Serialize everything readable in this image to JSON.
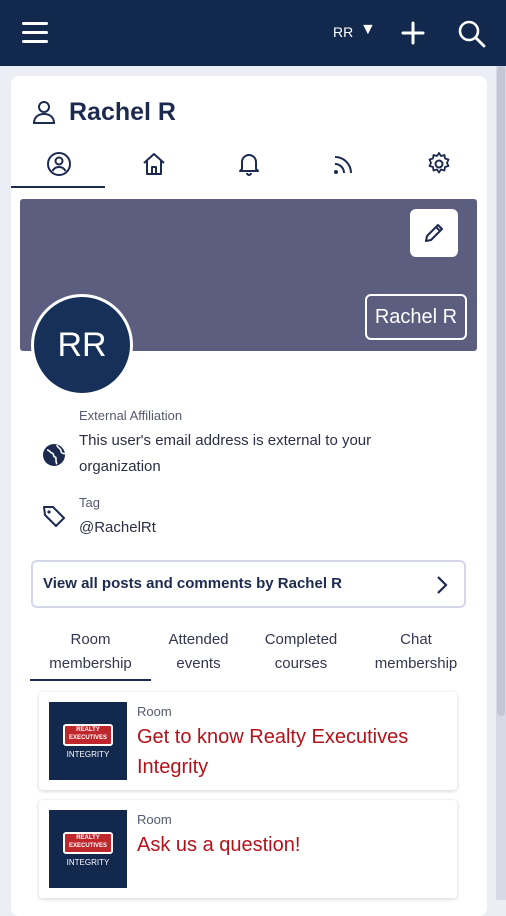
{
  "header": {
    "user_initials": "RR",
    "colors": {
      "bar": "#13284d",
      "accent": "#b3121a"
    }
  },
  "profile": {
    "name": "Rachel R",
    "avatar_initials": "RR",
    "banner_name": "Rachel R",
    "external_affiliation_label": "External Affiliation",
    "external_affiliation_value": "This user's email address is external to your organization",
    "tag_label": "Tag",
    "tag_value": "@RachelRt",
    "posts_link": "View all posts and comments by Rachel R"
  },
  "tabs": [
    "profile-icon",
    "home-icon",
    "bell-icon",
    "rss-icon",
    "gear-icon"
  ],
  "sub_tabs": [
    {
      "line1": "Room",
      "line2": "membership"
    },
    {
      "line1": "Attended",
      "line2": "events"
    },
    {
      "line1": "Completed",
      "line2": "courses"
    },
    {
      "line1": "Chat",
      "line2": "membership"
    }
  ],
  "rooms": [
    {
      "kind": "Room",
      "name": "Get to know Realty Executives Integrity",
      "logo_top": "REALTY",
      "logo_mid": "EXECUTIVES",
      "logo_sub": "INTEGRITY"
    },
    {
      "kind": "Room",
      "name": "Ask us a question!",
      "logo_top": "REALTY",
      "logo_mid": "EXECUTIVES",
      "logo_sub": "INTEGRITY"
    }
  ]
}
